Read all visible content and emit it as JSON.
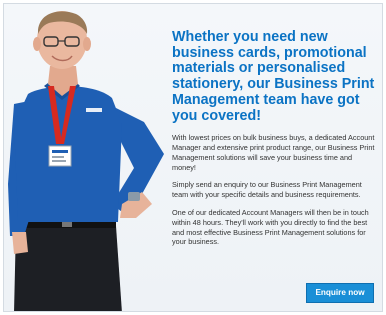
{
  "banner": {
    "headline": "Whether you need new business cards, promotional materials or personalised stationery, our Business Print Management team have got you covered!",
    "paragraphs": [
      "With lowest prices on bulk business buys, a dedicated Account Manager and extensive print product range, our Business Print Management solutions will save your business time and money!",
      "Simply send an enquiry to our Business Print Management team with your specific details and business requirements.",
      "One of our dedicated Account Managers will then be in touch within 48 hours. They'll work with you directly to find the best and most effective Business Print Management solutions for your business."
    ],
    "cta_label": "Enquire now"
  },
  "colors": {
    "headline": "#0b73c4",
    "button": "#1a8fd7",
    "shirt": "#1f5fb4",
    "lanyard": "#d62a20"
  }
}
